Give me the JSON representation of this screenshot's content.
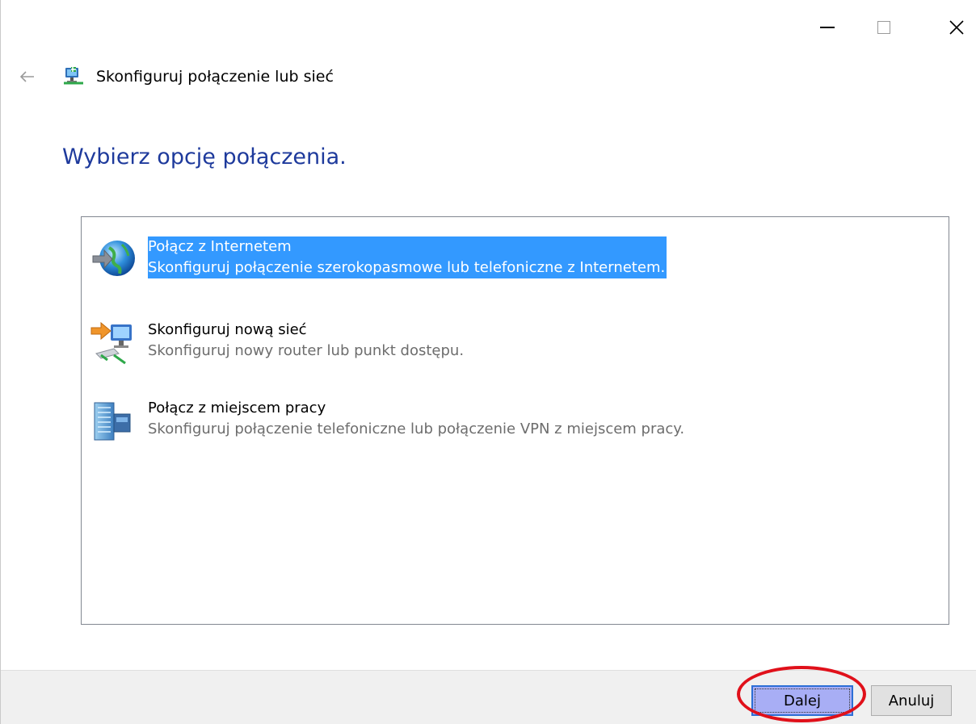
{
  "window": {
    "minimize_glyph": "—",
    "maximize_glyph": "☐",
    "close_glyph": "✕"
  },
  "header": {
    "back_glyph": "←",
    "title": "Skonfiguruj połączenie lub sieć",
    "icon": "network-setup-icon"
  },
  "heading": "Wybierz opcję połączenia.",
  "options": [
    {
      "title": "Połącz z Internetem",
      "description": "Skonfiguruj połączenie szerokopasmowe lub telefoniczne z Internetem.",
      "icon": "globe-icon",
      "selected": true
    },
    {
      "title": "Skonfiguruj nową sieć",
      "description": "Skonfiguruj nowy router lub punkt dostępu.",
      "icon": "router-icon",
      "selected": false
    },
    {
      "title": "Połącz z miejscem pracy",
      "description": "Skonfiguruj połączenie telefoniczne lub połączenie VPN z miejscem pracy.",
      "icon": "workplace-icon",
      "selected": false
    }
  ],
  "footer": {
    "next_label": "Dalej",
    "cancel_label": "Anuluj"
  },
  "colors": {
    "heading": "#1e3a9c",
    "selection": "#3399ff",
    "annotation": "#e0101a"
  }
}
